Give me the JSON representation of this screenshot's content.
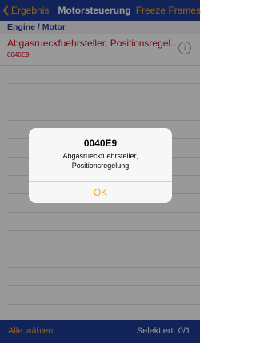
{
  "navbar": {
    "back_label": "Ergebnis",
    "title": "Motorsteuerung",
    "right_label": "Freeze Frames"
  },
  "section": {
    "header": "Engine / Motor"
  },
  "list": {
    "items": [
      {
        "title": "Abgasrueckfuehrsteller, Positionsregel…",
        "code": "0040E9"
      }
    ]
  },
  "alert": {
    "title": "0040E9",
    "message_line1": "Abgasrueckfuehrsteller,",
    "message_line2": "Positionsregelung",
    "ok_label": "OK"
  },
  "toolbar": {
    "select_all_label": "Alle wählen",
    "selected_text": "Selektiert:  0/1"
  },
  "colors": {
    "brand_blue": "#1e3b97",
    "accent_orange": "#f5a623",
    "error_red": "#d0021b"
  },
  "icons": [
    "chevron-left-icon",
    "info-icon"
  ]
}
